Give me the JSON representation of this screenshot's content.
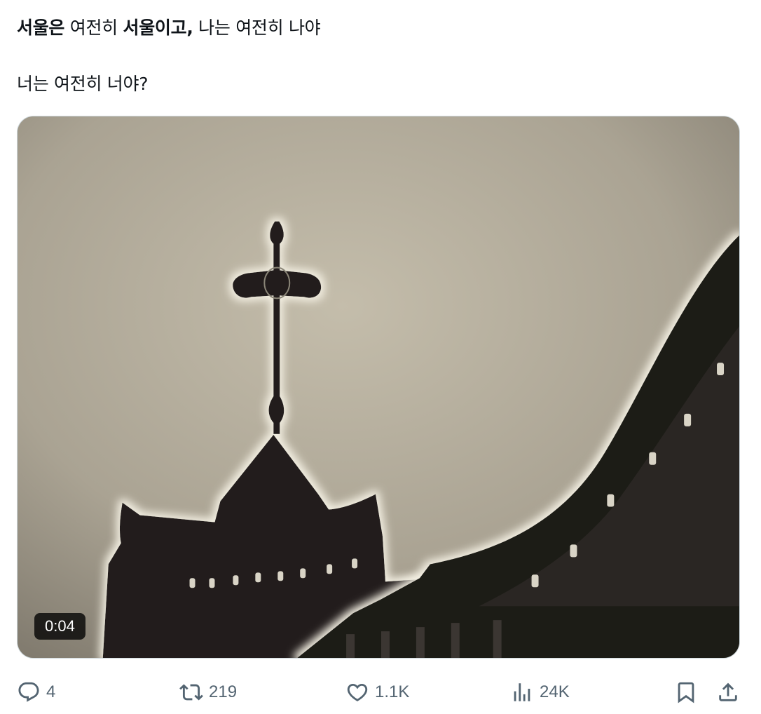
{
  "tweet": {
    "line1": {
      "part1_bold": "서울은",
      "part2": " 여전히 ",
      "part3_bold": "서울이고,",
      "part4": " 나는 여전히 나야"
    },
    "line2": "너는 여전히 너야?"
  },
  "media": {
    "type": "video",
    "duration": "0:04",
    "scene": "cross-on-church-roof"
  },
  "actions": {
    "reply_count": "4",
    "retweet_count": "219",
    "like_count": "1.1K",
    "views_count": "24K"
  },
  "icons": {
    "reply": "reply-icon",
    "retweet": "retweet-icon",
    "like": "heart-icon",
    "views": "views-icon",
    "bookmark": "bookmark-icon",
    "share": "share-icon"
  },
  "colors": {
    "text": "#0f1419",
    "secondary": "#536471",
    "border": "#cfd9de"
  }
}
